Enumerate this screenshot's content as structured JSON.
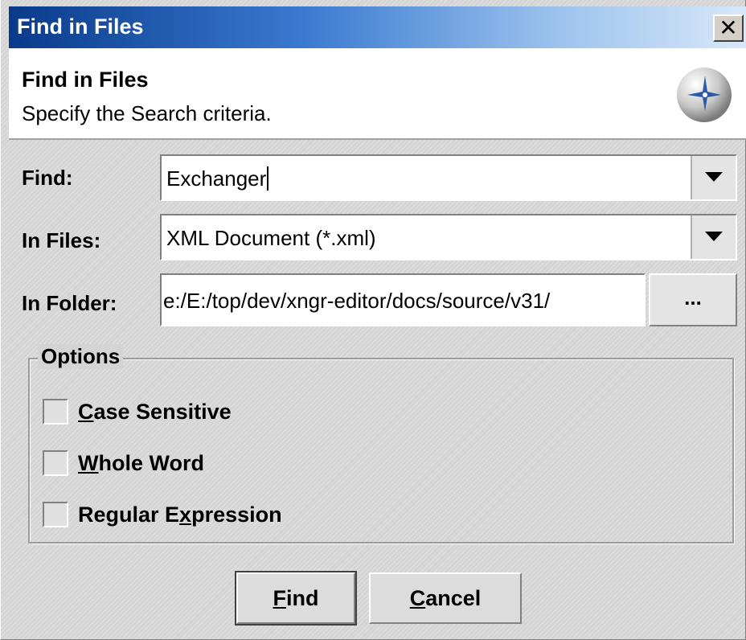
{
  "window": {
    "title": "Find in Files",
    "close_glyph": "✕"
  },
  "header": {
    "title": "Find in Files",
    "subtitle": "Specify the Search criteria.",
    "icon": "wizard-compass-icon"
  },
  "form": {
    "find": {
      "label": "Find:",
      "value": "Exchanger"
    },
    "in_files": {
      "label": "In Files:",
      "value": "XML Document (*.xml)"
    },
    "in_folder": {
      "label": "In Folder:",
      "value": "e:/E:/top/dev/xngr-editor/docs/source/v31/",
      "browse_label": "..."
    }
  },
  "options": {
    "legend": "Options",
    "case_sensitive": {
      "pre": "",
      "mnemonic": "C",
      "post": "ase Sensitive",
      "checked": false
    },
    "whole_word": {
      "pre": "",
      "mnemonic": "W",
      "post": "hole Word",
      "checked": false
    },
    "regular_expression": {
      "pre": "Regular E",
      "mnemonic": "x",
      "post": "pression",
      "checked": false
    }
  },
  "buttons": {
    "find": {
      "pre": "",
      "mnemonic": "F",
      "post": "ind"
    },
    "cancel": {
      "pre": "",
      "mnemonic": "C",
      "post": "ancel"
    }
  },
  "colors": {
    "titlebar_start": "#0a3a8a",
    "titlebar_end": "#d8e8f8",
    "dialog_bg": "#d4d4d4"
  }
}
